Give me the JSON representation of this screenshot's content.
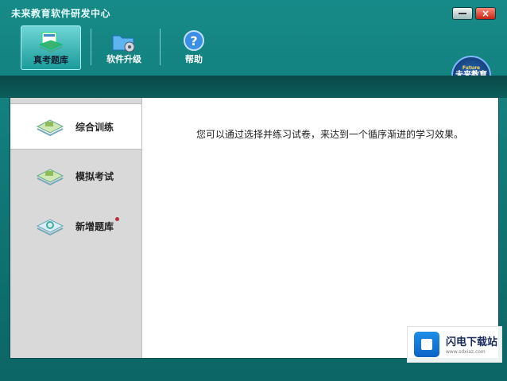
{
  "window": {
    "title": "未来教育软件研发中心",
    "close_label": "×"
  },
  "toolbar": {
    "items": [
      {
        "label": "真考题库",
        "icon": "book-stack-icon",
        "active": true
      },
      {
        "label": "软件升级",
        "icon": "folder-gear-icon",
        "active": false
      },
      {
        "label": "帮助",
        "icon": "help-icon",
        "active": false
      }
    ]
  },
  "logo": {
    "text": "未来教育",
    "subtext": "Future"
  },
  "sidebar": {
    "items": [
      {
        "label": "综合训练",
        "icon": "book-icon",
        "active": true
      },
      {
        "label": "模拟考试",
        "icon": "book-icon",
        "active": false
      },
      {
        "label": "新增题库",
        "icon": "book-refresh-icon",
        "active": false,
        "badge": true
      }
    ]
  },
  "main": {
    "description": "您可以通过选择并练习试卷，来达到一个循序渐进的学习效果。"
  },
  "watermark": {
    "title": "闪电下载站",
    "url": "www.sdxiaz.com"
  },
  "colors": {
    "frame": "#0f6f70",
    "toolbar_active": "#6fd5d6",
    "close_button": "#c52414",
    "sidebar_bg": "#d9d9d9"
  }
}
